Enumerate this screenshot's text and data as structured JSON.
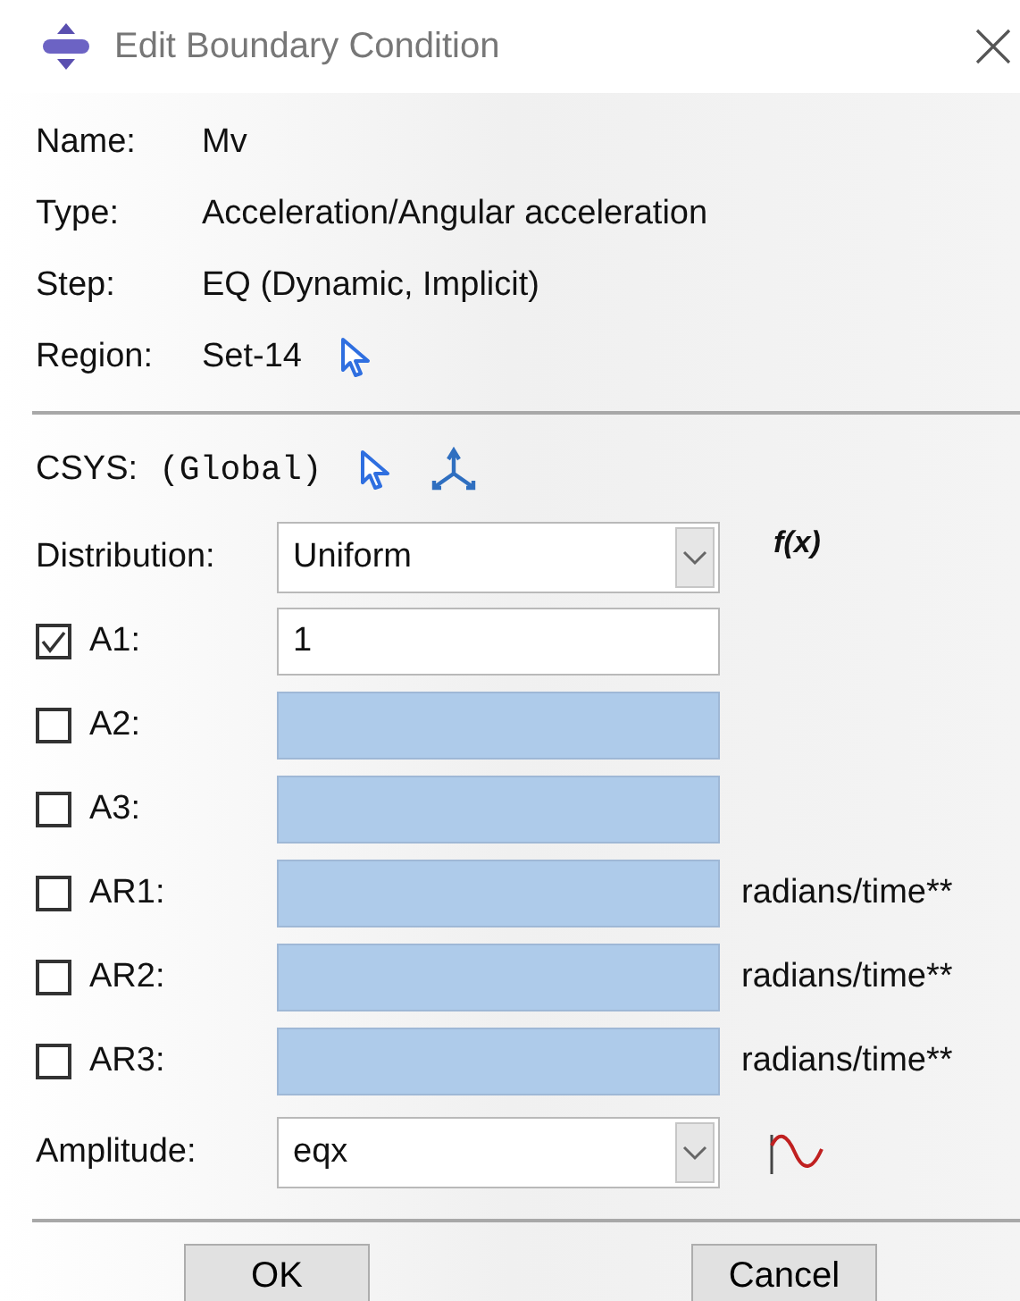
{
  "window": {
    "title": "Edit Boundary Condition"
  },
  "info": [
    {
      "label": "Name:",
      "value": "Mv",
      "kind": "text"
    },
    {
      "label": "Type:",
      "value": "Acceleration/Angular acceleration",
      "kind": "text"
    },
    {
      "label": "Step:",
      "value": "EQ (Dynamic, Implicit)",
      "kind": "text"
    },
    {
      "label": "Region:",
      "value": "Set-14",
      "kind": "pick"
    }
  ],
  "csys": {
    "label": "CSYS:",
    "value": "(Global)"
  },
  "distribution": {
    "label": "Distribution:",
    "value": "Uniform",
    "function_label": "f(x)"
  },
  "components": [
    {
      "label": "A1:",
      "checked": true,
      "value": "1"
    },
    {
      "label": "A2:",
      "checked": false
    },
    {
      "label": "A3:",
      "checked": false
    },
    {
      "label": "AR1:",
      "checked": false,
      "unit": "radians/time**"
    },
    {
      "label": "AR2:",
      "checked": false,
      "unit": "radians/time**"
    },
    {
      "label": "AR3:",
      "checked": false,
      "unit": "radians/time**"
    }
  ],
  "amplitude": {
    "label": "Amplitude:",
    "value": "eqx"
  },
  "buttons": [
    "OK",
    "Cancel"
  ]
}
